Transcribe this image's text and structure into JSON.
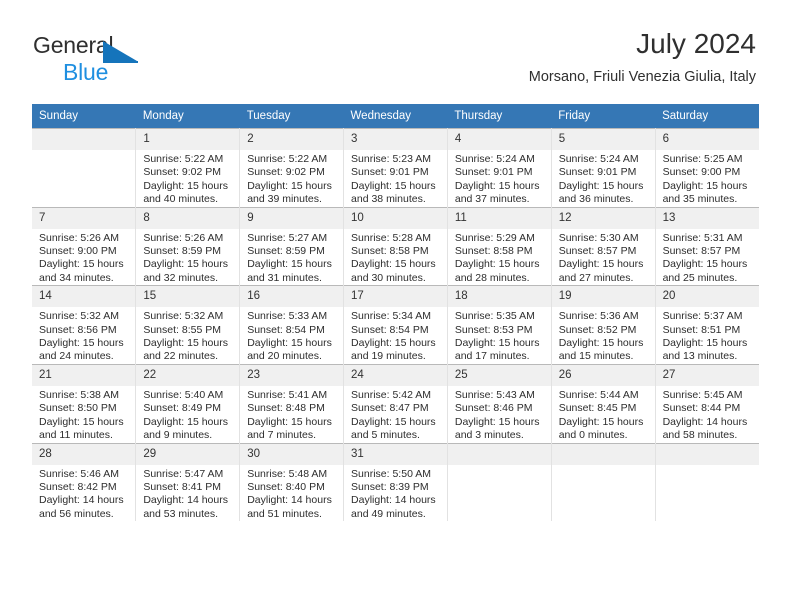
{
  "brand": {
    "name_part1": "General",
    "name_part2": "Blue",
    "triangle_icon": "triangle-icon",
    "color_dark": "#2f2f2f",
    "color_blue": "#1f8fe0"
  },
  "header": {
    "title": "July 2024",
    "subtitle": "Morsano, Friuli Venezia Giulia, Italy",
    "accent_color": "#3577b5"
  },
  "calendar": {
    "weekday_headers": [
      "Sunday",
      "Monday",
      "Tuesday",
      "Wednesday",
      "Thursday",
      "Friday",
      "Saturday"
    ],
    "labels": {
      "sunrise": "Sunrise:",
      "sunset": "Sunset:",
      "daylight": "Daylight:"
    },
    "weeks": [
      [
        {
          "day": "",
          "sunrise": "",
          "sunset": "",
          "daylight_line1": "",
          "daylight_line2": ""
        },
        {
          "day": "1",
          "sunrise": "Sunrise: 5:22 AM",
          "sunset": "Sunset: 9:02 PM",
          "daylight_line1": "Daylight: 15 hours",
          "daylight_line2": "and 40 minutes."
        },
        {
          "day": "2",
          "sunrise": "Sunrise: 5:22 AM",
          "sunset": "Sunset: 9:02 PM",
          "daylight_line1": "Daylight: 15 hours",
          "daylight_line2": "and 39 minutes."
        },
        {
          "day": "3",
          "sunrise": "Sunrise: 5:23 AM",
          "sunset": "Sunset: 9:01 PM",
          "daylight_line1": "Daylight: 15 hours",
          "daylight_line2": "and 38 minutes."
        },
        {
          "day": "4",
          "sunrise": "Sunrise: 5:24 AM",
          "sunset": "Sunset: 9:01 PM",
          "daylight_line1": "Daylight: 15 hours",
          "daylight_line2": "and 37 minutes."
        },
        {
          "day": "5",
          "sunrise": "Sunrise: 5:24 AM",
          "sunset": "Sunset: 9:01 PM",
          "daylight_line1": "Daylight: 15 hours",
          "daylight_line2": "and 36 minutes."
        },
        {
          "day": "6",
          "sunrise": "Sunrise: 5:25 AM",
          "sunset": "Sunset: 9:00 PM",
          "daylight_line1": "Daylight: 15 hours",
          "daylight_line2": "and 35 minutes."
        }
      ],
      [
        {
          "day": "7",
          "sunrise": "Sunrise: 5:26 AM",
          "sunset": "Sunset: 9:00 PM",
          "daylight_line1": "Daylight: 15 hours",
          "daylight_line2": "and 34 minutes."
        },
        {
          "day": "8",
          "sunrise": "Sunrise: 5:26 AM",
          "sunset": "Sunset: 8:59 PM",
          "daylight_line1": "Daylight: 15 hours",
          "daylight_line2": "and 32 minutes."
        },
        {
          "day": "9",
          "sunrise": "Sunrise: 5:27 AM",
          "sunset": "Sunset: 8:59 PM",
          "daylight_line1": "Daylight: 15 hours",
          "daylight_line2": "and 31 minutes."
        },
        {
          "day": "10",
          "sunrise": "Sunrise: 5:28 AM",
          "sunset": "Sunset: 8:58 PM",
          "daylight_line1": "Daylight: 15 hours",
          "daylight_line2": "and 30 minutes."
        },
        {
          "day": "11",
          "sunrise": "Sunrise: 5:29 AM",
          "sunset": "Sunset: 8:58 PM",
          "daylight_line1": "Daylight: 15 hours",
          "daylight_line2": "and 28 minutes."
        },
        {
          "day": "12",
          "sunrise": "Sunrise: 5:30 AM",
          "sunset": "Sunset: 8:57 PM",
          "daylight_line1": "Daylight: 15 hours",
          "daylight_line2": "and 27 minutes."
        },
        {
          "day": "13",
          "sunrise": "Sunrise: 5:31 AM",
          "sunset": "Sunset: 8:57 PM",
          "daylight_line1": "Daylight: 15 hours",
          "daylight_line2": "and 25 minutes."
        }
      ],
      [
        {
          "day": "14",
          "sunrise": "Sunrise: 5:32 AM",
          "sunset": "Sunset: 8:56 PM",
          "daylight_line1": "Daylight: 15 hours",
          "daylight_line2": "and 24 minutes."
        },
        {
          "day": "15",
          "sunrise": "Sunrise: 5:32 AM",
          "sunset": "Sunset: 8:55 PM",
          "daylight_line1": "Daylight: 15 hours",
          "daylight_line2": "and 22 minutes."
        },
        {
          "day": "16",
          "sunrise": "Sunrise: 5:33 AM",
          "sunset": "Sunset: 8:54 PM",
          "daylight_line1": "Daylight: 15 hours",
          "daylight_line2": "and 20 minutes."
        },
        {
          "day": "17",
          "sunrise": "Sunrise: 5:34 AM",
          "sunset": "Sunset: 8:54 PM",
          "daylight_line1": "Daylight: 15 hours",
          "daylight_line2": "and 19 minutes."
        },
        {
          "day": "18",
          "sunrise": "Sunrise: 5:35 AM",
          "sunset": "Sunset: 8:53 PM",
          "daylight_line1": "Daylight: 15 hours",
          "daylight_line2": "and 17 minutes."
        },
        {
          "day": "19",
          "sunrise": "Sunrise: 5:36 AM",
          "sunset": "Sunset: 8:52 PM",
          "daylight_line1": "Daylight: 15 hours",
          "daylight_line2": "and 15 minutes."
        },
        {
          "day": "20",
          "sunrise": "Sunrise: 5:37 AM",
          "sunset": "Sunset: 8:51 PM",
          "daylight_line1": "Daylight: 15 hours",
          "daylight_line2": "and 13 minutes."
        }
      ],
      [
        {
          "day": "21",
          "sunrise": "Sunrise: 5:38 AM",
          "sunset": "Sunset: 8:50 PM",
          "daylight_line1": "Daylight: 15 hours",
          "daylight_line2": "and 11 minutes."
        },
        {
          "day": "22",
          "sunrise": "Sunrise: 5:40 AM",
          "sunset": "Sunset: 8:49 PM",
          "daylight_line1": "Daylight: 15 hours",
          "daylight_line2": "and 9 minutes."
        },
        {
          "day": "23",
          "sunrise": "Sunrise: 5:41 AM",
          "sunset": "Sunset: 8:48 PM",
          "daylight_line1": "Daylight: 15 hours",
          "daylight_line2": "and 7 minutes."
        },
        {
          "day": "24",
          "sunrise": "Sunrise: 5:42 AM",
          "sunset": "Sunset: 8:47 PM",
          "daylight_line1": "Daylight: 15 hours",
          "daylight_line2": "and 5 minutes."
        },
        {
          "day": "25",
          "sunrise": "Sunrise: 5:43 AM",
          "sunset": "Sunset: 8:46 PM",
          "daylight_line1": "Daylight: 15 hours",
          "daylight_line2": "and 3 minutes."
        },
        {
          "day": "26",
          "sunrise": "Sunrise: 5:44 AM",
          "sunset": "Sunset: 8:45 PM",
          "daylight_line1": "Daylight: 15 hours",
          "daylight_line2": "and 0 minutes."
        },
        {
          "day": "27",
          "sunrise": "Sunrise: 5:45 AM",
          "sunset": "Sunset: 8:44 PM",
          "daylight_line1": "Daylight: 14 hours",
          "daylight_line2": "and 58 minutes."
        }
      ],
      [
        {
          "day": "28",
          "sunrise": "Sunrise: 5:46 AM",
          "sunset": "Sunset: 8:42 PM",
          "daylight_line1": "Daylight: 14 hours",
          "daylight_line2": "and 56 minutes."
        },
        {
          "day": "29",
          "sunrise": "Sunrise: 5:47 AM",
          "sunset": "Sunset: 8:41 PM",
          "daylight_line1": "Daylight: 14 hours",
          "daylight_line2": "and 53 minutes."
        },
        {
          "day": "30",
          "sunrise": "Sunrise: 5:48 AM",
          "sunset": "Sunset: 8:40 PM",
          "daylight_line1": "Daylight: 14 hours",
          "daylight_line2": "and 51 minutes."
        },
        {
          "day": "31",
          "sunrise": "Sunrise: 5:50 AM",
          "sunset": "Sunset: 8:39 PM",
          "daylight_line1": "Daylight: 14 hours",
          "daylight_line2": "and 49 minutes."
        },
        {
          "day": "",
          "sunrise": "",
          "sunset": "",
          "daylight_line1": "",
          "daylight_line2": ""
        },
        {
          "day": "",
          "sunrise": "",
          "sunset": "",
          "daylight_line1": "",
          "daylight_line2": ""
        },
        {
          "day": "",
          "sunrise": "",
          "sunset": "",
          "daylight_line1": "",
          "daylight_line2": ""
        }
      ]
    ]
  }
}
